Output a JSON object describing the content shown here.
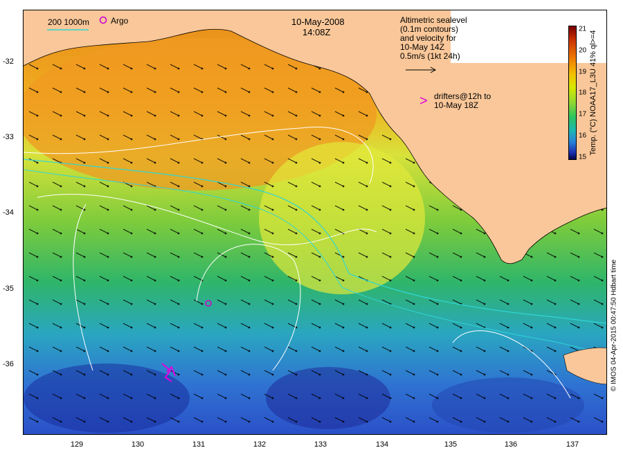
{
  "header": {
    "date": "10-May-2008",
    "time": "14:08Z"
  },
  "legend": {
    "contour_depths": "200  1000m",
    "argo_label": "Argo",
    "altimetry_lines": [
      "Altimetric sealevel",
      "(0.1m contours)",
      "and velocity for",
      "10-May 14Z",
      "0.5m/s (1kt 24h)"
    ],
    "drifter_symbol": ">",
    "drifter_lines": [
      "drifters@12h to",
      "10-May 18Z"
    ]
  },
  "axes": {
    "y_ticks": [
      "-32",
      "-33",
      "-34",
      "-35",
      "-36"
    ],
    "x_ticks": [
      "129",
      "130",
      "131",
      "132",
      "133",
      "134",
      "135",
      "136",
      "137"
    ]
  },
  "colorbar": {
    "title": "Temp. (°C) NOAA17_L3U 41% ql>=4",
    "labels": [
      "21",
      "20",
      "19",
      "18",
      "17",
      "16",
      "15"
    ],
    "min": 15,
    "max": 21
  },
  "credit": "© IMOS 04-Apr-2015 00:47:50 Hdbart time",
  "colors": {
    "land": "#f9c799",
    "argo": "#d000d0",
    "drifter": "#e000e0",
    "isobath": "#2fd6d6",
    "contour": "#ffffff"
  }
}
